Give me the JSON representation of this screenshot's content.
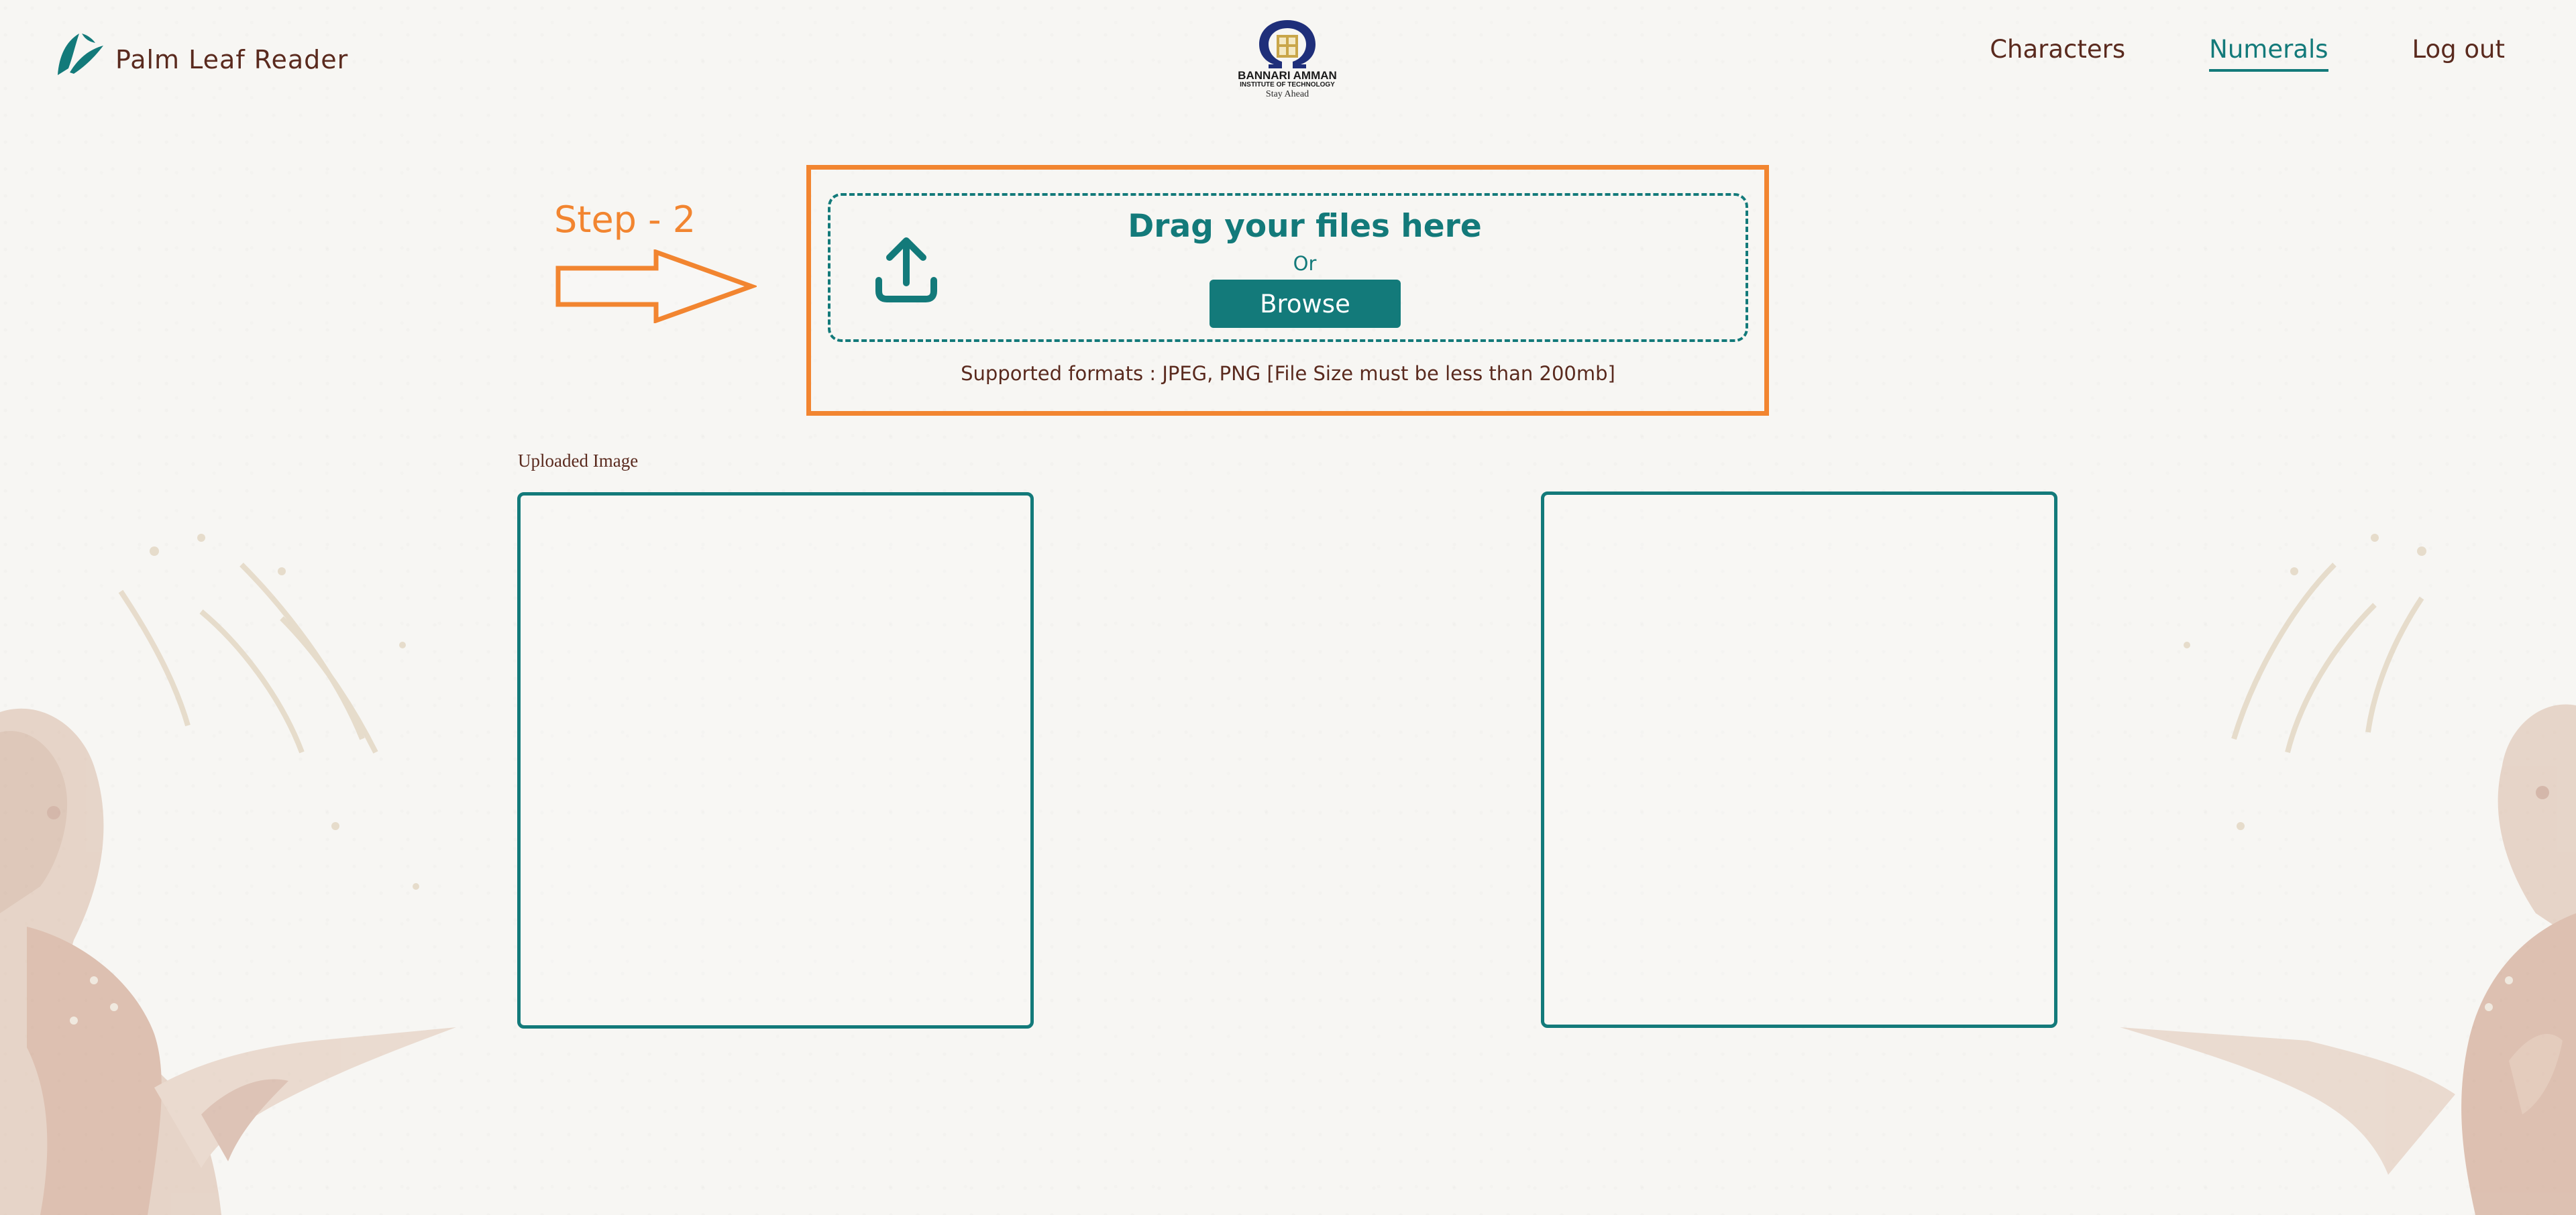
{
  "header": {
    "brand_name": "Palm Leaf Reader",
    "logo": {
      "name": "BANNARI AMMAN",
      "subtitle": "INSTITUTE OF TECHNOLOGY",
      "tagline": "Stay Ahead"
    },
    "nav": [
      {
        "label": "Characters",
        "active": false
      },
      {
        "label": "Numerals",
        "active": true
      },
      {
        "label": "Log out",
        "active": false
      }
    ]
  },
  "annotation": {
    "step_label": "Step - 2",
    "color": "#f28530"
  },
  "upload": {
    "title": "Drag your files here",
    "or_text": "Or",
    "browse_label": "Browse",
    "formats_text": "Supported formats : JPEG, PNG [File Size must be less than 200mb]",
    "icon": "upload-icon"
  },
  "panels": {
    "uploaded_label": "Uploaded Image"
  },
  "colors": {
    "accent": "#137a7a",
    "brand_text": "#5a2a1e",
    "highlight": "#f28530",
    "background": "#f7f6f3"
  }
}
